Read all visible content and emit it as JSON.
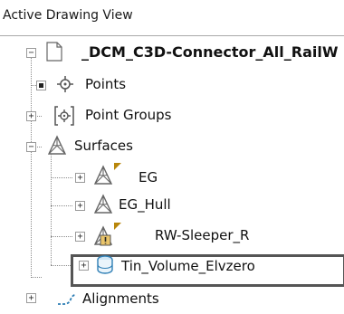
{
  "header": {
    "title": "Active Drawing View"
  },
  "tree": {
    "root": {
      "label": "_DCM_C3D-Connector_All_RailW",
      "expander": "−"
    },
    "points": {
      "label": "Points"
    },
    "point_groups": {
      "label": "Point Groups",
      "expander": "+"
    },
    "surfaces": {
      "label": "Surfaces",
      "expander": "−",
      "children": [
        {
          "label": "EG",
          "expander": "+"
        },
        {
          "label": "EG_Hull",
          "expander": "+"
        },
        {
          "label": "RW-Sleeper_R",
          "expander": "+"
        },
        {
          "label": "Tin_Volume_Elvzero",
          "expander": "+"
        }
      ]
    },
    "alignments": {
      "label": "Alignments",
      "expander": "+"
    }
  },
  "colors": {
    "flag_marker": "#b8860b",
    "selection_border": "#555555",
    "volume_icon": "#2f7fb5"
  }
}
